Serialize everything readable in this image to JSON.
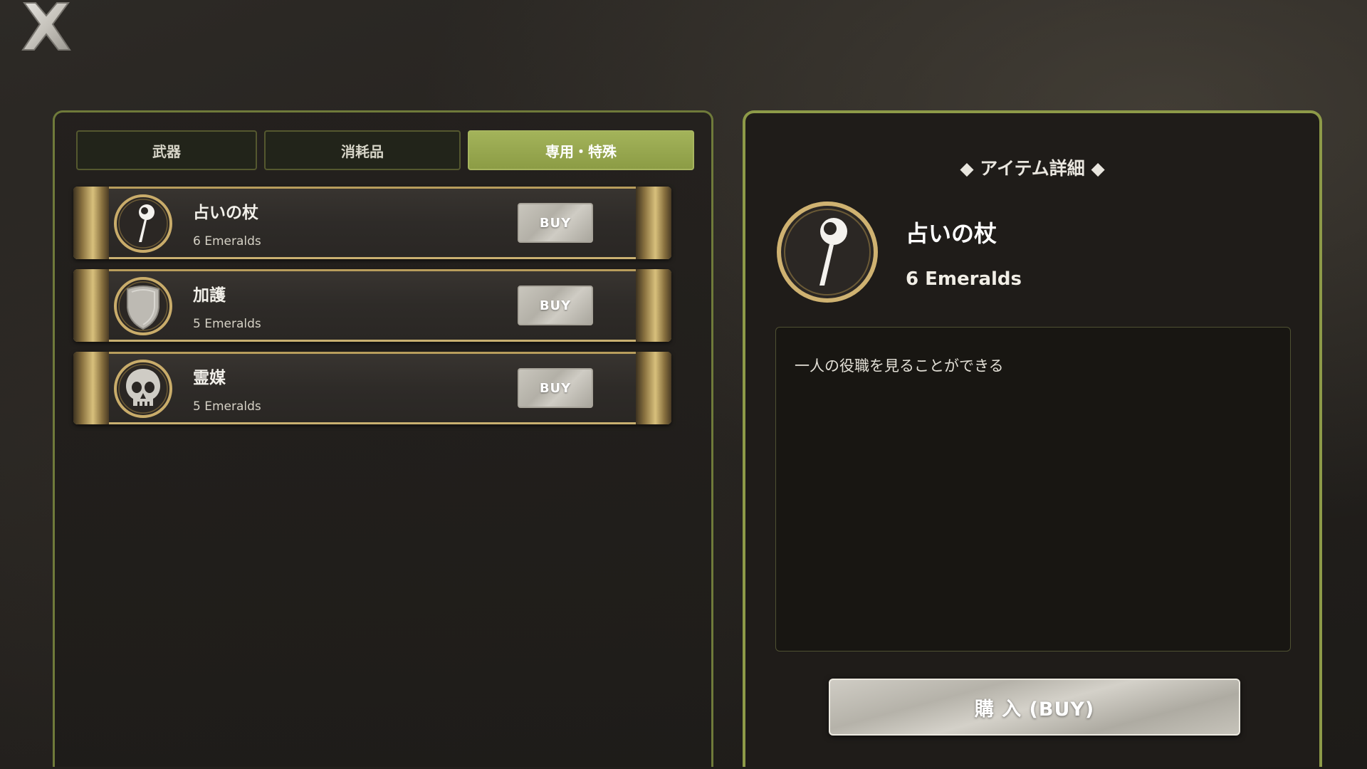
{
  "close_button": {
    "icon": "close-x-icon"
  },
  "tabs": [
    {
      "label": "武器",
      "active": false
    },
    {
      "label": "消耗品",
      "active": false
    },
    {
      "label": "専用・特殊",
      "active": true
    }
  ],
  "items": [
    {
      "name": "占いの杖",
      "price": "6 Emeralds",
      "buy_label": "BUY",
      "icon": "fortune-staff-icon"
    },
    {
      "name": "加護",
      "price": "5 Emeralds",
      "buy_label": "BUY",
      "icon": "shield-icon"
    },
    {
      "name": "霊媒",
      "price": "5 Emeralds",
      "buy_label": "BUY",
      "icon": "skull-icon"
    }
  ],
  "detail": {
    "header": "◆ アイテム詳細 ◆",
    "name": "占いの杖",
    "price": "6 Emeralds",
    "icon": "fortune-staff-icon",
    "description": "一人の役職を見ることができる",
    "purchase_label": "購 入 (BUY)"
  },
  "colors": {
    "accent_green": "#8d9a48",
    "active_tab": "#9aab52",
    "gold_trim": "#c9b070",
    "silver_button": "#bdbab1"
  }
}
